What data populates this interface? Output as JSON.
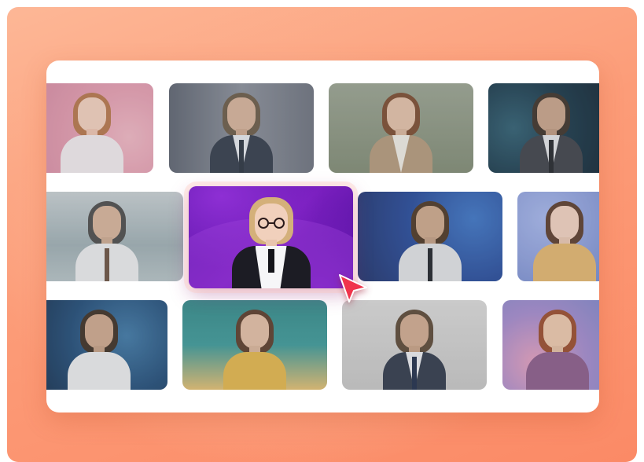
{
  "page": {
    "title": ""
  },
  "colors": {
    "background_gradient_start": "#fdb796",
    "background_gradient_end": "#fb8a66",
    "panel": "#ffffff",
    "featured": "#7a1fbf",
    "cursor": "#f0344c"
  },
  "avatars": {
    "row1": [
      {
        "name": "cartoon-woman-pink",
        "style": "cartoon"
      },
      {
        "name": "businessman-glasses",
        "style": "photo"
      },
      {
        "name": "businesswoman-tan-blazer",
        "style": "photo"
      },
      {
        "name": "businessman-tech-globe",
        "style": "photo"
      }
    ],
    "row2": [
      {
        "name": "doctor-mountains",
        "style": "photo"
      },
      {
        "name": "featured-woman-glasses-purple",
        "style": "photo",
        "selected": true
      },
      {
        "name": "man-blue-tech-background",
        "style": "photo"
      },
      {
        "name": "cartoon-girl-clouds",
        "style": "cartoon"
      }
    ],
    "row3": [
      {
        "name": "man-white-shirt-night-sky",
        "style": "photo"
      },
      {
        "name": "woman-rainbow-background",
        "style": "photo"
      },
      {
        "name": "businessman-gray",
        "style": "photo"
      },
      {
        "name": "woman-red-hair-stars",
        "style": "photo"
      }
    ]
  },
  "icons": {
    "pointer": "cursor-arrow-icon"
  }
}
